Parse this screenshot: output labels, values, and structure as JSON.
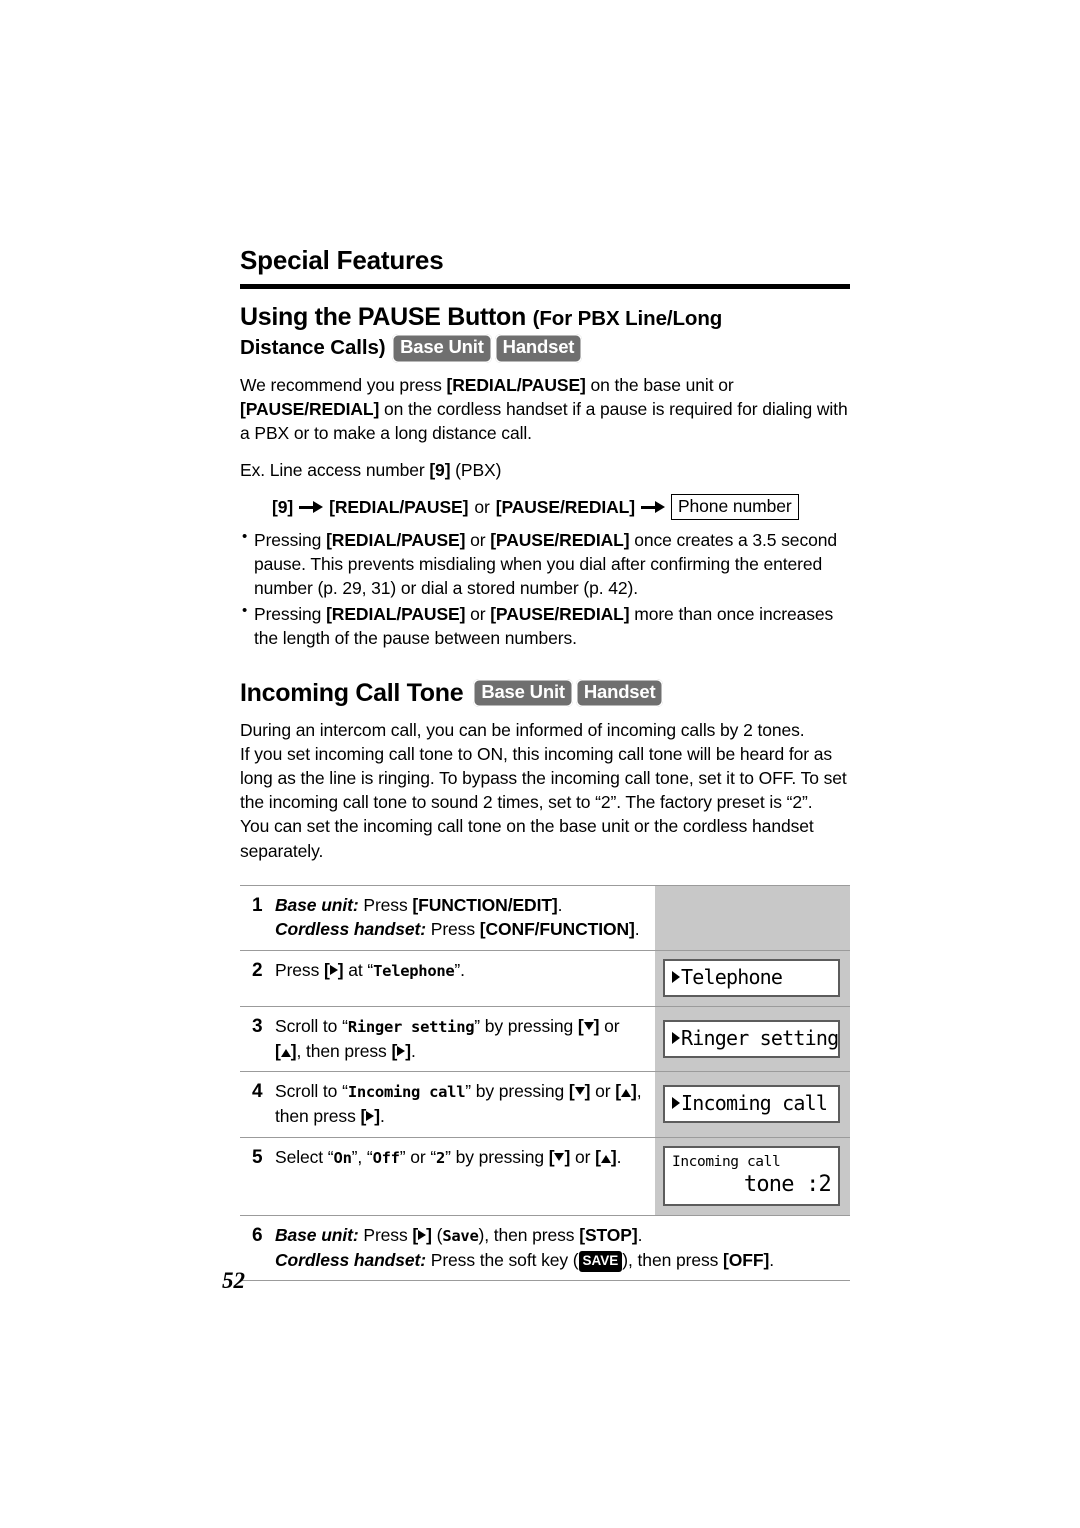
{
  "document": {
    "section_title": "Special Features",
    "page_number": "52"
  },
  "badges": {
    "base_unit": "Base Unit",
    "handset": "Handset"
  },
  "pause_section": {
    "heading_main": "Using the PAUSE Button",
    "heading_paren": "(For PBX Line/Long",
    "heading_line2": "Distance Calls)",
    "intro": {
      "t1": "We recommend you press ",
      "k1": "[REDIAL/PAUSE]",
      "t2": " on the base unit or ",
      "k2": "[PAUSE/REDIAL]",
      "t3": " on the cordless handset if a pause is required for dialing with a PBX or to make a long distance call."
    },
    "example_line": {
      "t1": "Ex. Line access number ",
      "k1": "[9]",
      "t2": " (PBX)"
    },
    "flow": {
      "step1": "[9]",
      "step2": "[REDIAL/PAUSE]",
      "or": " or ",
      "step3": "[PAUSE/REDIAL]",
      "step4": "Phone number"
    },
    "bullets": [
      {
        "t1": "Pressing ",
        "k1": "[REDIAL/PAUSE]",
        "t2": " or ",
        "k2": "[PAUSE/REDIAL]",
        "t3": " once creates a 3.5 second pause. This prevents misdialing when you dial after confirming the entered number (p. 29, 31) or dial a stored number (p. 42)."
      },
      {
        "t1": "Pressing ",
        "k1": "[REDIAL/PAUSE]",
        "t2": " or ",
        "k2": "[PAUSE/REDIAL]",
        "t3": " more than once increases the length of the pause between numbers."
      }
    ]
  },
  "tone_section": {
    "heading": "Incoming Call Tone",
    "paragraph": "During an intercom call, you can be informed of incoming calls by 2 tones.\nIf you set incoming call tone to ON, this incoming call tone will be heard for as long as the line is ringing. To bypass the incoming call tone, set it to OFF. To set the incoming call tone to sound 2 times, set to “2”. The factory preset is “2”.\nYou can set the incoming call tone on the base unit or the cordless handset separately.",
    "steps": [
      {
        "number": "1",
        "line1": {
          "label": "Base unit:",
          "t1": " Press ",
          "k1": "[FUNCTION/EDIT]",
          "t2": "."
        },
        "line2": {
          "label": "Cordless handset:",
          "t1": " Press ",
          "k1": "[CONF/FUNCTION]",
          "t2": "."
        },
        "lcd": null
      },
      {
        "number": "2",
        "text": {
          "t1": "Press ",
          "key_right": "[▶]",
          "t2": " at “",
          "mono": "Telephone",
          "t3": "”."
        },
        "lcd": {
          "type": "menu",
          "line1": "Telephone"
        }
      },
      {
        "number": "3",
        "text": {
          "t1": "Scroll to “",
          "mono": "Ringer setting",
          "t2": "” by pressing ",
          "key_down": "[▼]",
          "t3": " or ",
          "key_up": "[▲]",
          "t4": ", then press ",
          "key_right": "[▶]",
          "t5": "."
        },
        "lcd": {
          "type": "menu",
          "line1": "Ringer setting"
        }
      },
      {
        "number": "4",
        "text": {
          "t1": "Scroll to “",
          "mono": "Incoming call",
          "t2": "” by pressing ",
          "key_down": "[▼]",
          "t3": " or ",
          "key_up": "[▲]",
          "t4": ", then press ",
          "key_right": "[▶]",
          "t5": "."
        },
        "lcd": {
          "type": "menu",
          "line1": "Incoming call"
        }
      },
      {
        "number": "5",
        "text": {
          "t1": "Select “",
          "mono1": "On",
          "t2": "”, “",
          "mono2": "Off",
          "t3": "” or “",
          "mono3": "2",
          "t4": "” by pressing ",
          "key_down": "[▼]",
          "t5": " or ",
          "key_up": "[▲]",
          "t6": "."
        },
        "lcd": {
          "type": "value",
          "line1": "Incoming call",
          "line2": "tone :2"
        }
      },
      {
        "number": "6",
        "line1": {
          "label": "Base unit:",
          "t1": " Press ",
          "key_right": "[▶]",
          "t2": " (",
          "mono": "Save",
          "t3": "), then press ",
          "k1": "[STOP]",
          "t4": "."
        },
        "line2": {
          "label": "Cordless handset:",
          "t1": " Press the soft key (",
          "softkey": "SAVE",
          "t2": "), then press ",
          "k1": "[OFF]",
          "t3": "."
        },
        "lcd": null
      }
    ]
  }
}
